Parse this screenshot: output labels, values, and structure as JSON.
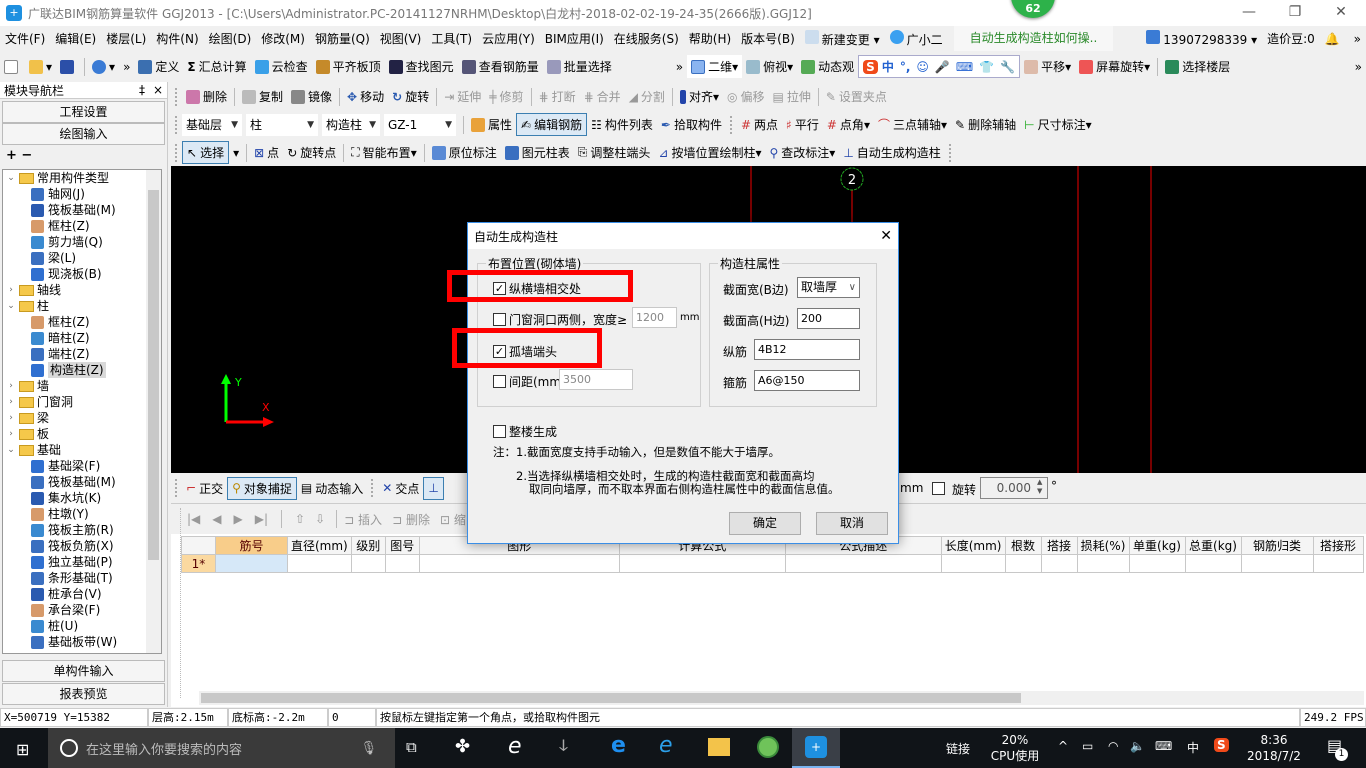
{
  "window": {
    "title": "广联达BIM钢筋算量软件 GGJ2013 - [C:\\Users\\Administrator.PC-20141127NRHM\\Desktop\\白龙村-2018-02-02-19-24-35(2666版).GGJ12]",
    "badge": "62",
    "minimize": "—",
    "restore": "❐",
    "close": "✕"
  },
  "menu": {
    "items": [
      "文件(F)",
      "编辑(E)",
      "楼层(L)",
      "构件(N)",
      "绘图(D)",
      "修改(M)",
      "钢筋量(Q)",
      "视图(V)",
      "工具(T)",
      "云应用(Y)",
      "BIM应用(I)",
      "在线服务(S)",
      "帮助(H)",
      "版本号(B)"
    ],
    "new_change": "新建变更",
    "assistant": "广小二",
    "help_prompt": "自动生成构造柱如何操..",
    "user": "13907298339",
    "beans": "造价豆:0",
    "more": "»"
  },
  "toolbar1": {
    "items": [
      "定义",
      "汇总计算",
      "云检查",
      "平齐板顶",
      "查找图元",
      "查看钢筋量",
      "批量选择"
    ],
    "right": [
      "二维",
      "俯视",
      "动态观"
    ],
    "ime": [
      "中",
      "°,",
      "☺",
      "🎤",
      "⌨"
    ],
    "right2": [
      "平移",
      "屏幕旋转",
      "选择楼层"
    ]
  },
  "toolbar2": {
    "items": [
      "删除",
      "复制",
      "镜像",
      "移动",
      "旋转",
      "延伸",
      "修剪",
      "打断",
      "合并",
      "分割",
      "对齐",
      "偏移",
      "拉伸",
      "设置夹点"
    ],
    "disabled": [
      "延伸",
      "修剪",
      "打断",
      "合并",
      "分割",
      "偏移",
      "拉伸",
      "设置夹点"
    ]
  },
  "toolbar3": {
    "floor": "基础层",
    "type": "柱",
    "subtype": "构造柱",
    "component": "GZ-1",
    "items": [
      "属性",
      "编辑钢筋",
      "构件列表",
      "拾取构件",
      "两点",
      "平行",
      "点角",
      "三点辅轴",
      "删除辅轴",
      "尺寸标注"
    ]
  },
  "toolbar4": {
    "items": [
      "选择",
      "点",
      "旋转点",
      "智能布置",
      "原位标注",
      "图元柱表",
      "调整柱端头",
      "按墙位置绘制柱",
      "查改标注",
      "自动生成构造柱"
    ]
  },
  "nav": {
    "title": "模块导航栏",
    "pin": "‡",
    "close": "×",
    "buttons": [
      "工程设置",
      "绘图输入"
    ],
    "bottom_buttons": [
      "单构件输入",
      "报表预览"
    ],
    "expand_collapse": "+ −",
    "tree": [
      {
        "label": "常用构件类型",
        "level": 0,
        "expanded": true
      },
      {
        "label": "轴网(J)",
        "level": 1
      },
      {
        "label": "筏板基础(M)",
        "level": 1
      },
      {
        "label": "框柱(Z)",
        "level": 1
      },
      {
        "label": "剪力墙(Q)",
        "level": 1
      },
      {
        "label": "梁(L)",
        "level": 1
      },
      {
        "label": "现浇板(B)",
        "level": 1
      },
      {
        "label": "轴线",
        "level": 0,
        "expanded": false
      },
      {
        "label": "柱",
        "level": 0,
        "expanded": true
      },
      {
        "label": "框柱(Z)",
        "level": 1
      },
      {
        "label": "暗柱(Z)",
        "level": 1
      },
      {
        "label": "端柱(Z)",
        "level": 1
      },
      {
        "label": "构造柱(Z)",
        "level": 1,
        "selected": true
      },
      {
        "label": "墙",
        "level": 0,
        "expanded": false
      },
      {
        "label": "门窗洞",
        "level": 0,
        "expanded": false
      },
      {
        "label": "梁",
        "level": 0,
        "expanded": false
      },
      {
        "label": "板",
        "level": 0,
        "expanded": false
      },
      {
        "label": "基础",
        "level": 0,
        "expanded": true
      },
      {
        "label": "基础梁(F)",
        "level": 1
      },
      {
        "label": "筏板基础(M)",
        "level": 1
      },
      {
        "label": "集水坑(K)",
        "level": 1
      },
      {
        "label": "柱墩(Y)",
        "level": 1
      },
      {
        "label": "筏板主筋(R)",
        "level": 1
      },
      {
        "label": "筏板负筋(X)",
        "level": 1
      },
      {
        "label": "独立基础(P)",
        "level": 1
      },
      {
        "label": "条形基础(T)",
        "level": 1
      },
      {
        "label": "桩承台(V)",
        "level": 1
      },
      {
        "label": "承台梁(F)",
        "level": 1
      },
      {
        "label": "桩(U)",
        "level": 1
      },
      {
        "label": "基础板带(W)",
        "level": 1
      }
    ]
  },
  "canvas": {
    "axis_label": "2",
    "y_label": "Y",
    "x_label": "X"
  },
  "snapbar": {
    "items": [
      "正交",
      "对象捕捉",
      "动态输入",
      "交点"
    ],
    "unit": "mm",
    "rotate_label": "旋转",
    "rotate_value": "0.000",
    "degree": "°"
  },
  "grid": {
    "toolbar": [
      "插入",
      "删除",
      "缩"
    ],
    "columns": [
      "",
      "筋号",
      "直径(mm)",
      "级别",
      "图号",
      "图形",
      "计算公式",
      "公式描述",
      "长度(mm)",
      "根数",
      "搭接",
      "损耗(%)",
      "单重(kg)",
      "总重(kg)",
      "钢筋归类",
      "搭接形"
    ],
    "rows": [
      [
        "1*",
        "",
        "",
        "",
        "",
        "",
        "",
        "",
        "",
        "",
        "",
        "",
        "",
        "",
        "",
        ""
      ]
    ]
  },
  "status": {
    "coords": "X=500719 Y=15382",
    "floor_height": "层高:2.15m",
    "base_elev": "底标高:-2.2m",
    "zero": "0",
    "hint": "按鼠标左键指定第一个角点，或拾取构件图元",
    "fps": "249.2 FPS"
  },
  "taskbar": {
    "search_placeholder": "在这里输入你要搜索的内容",
    "link": "链接",
    "cpu_pct": "20%",
    "cpu_label": "CPU使用",
    "ime": "中",
    "time": "8:36",
    "date": "2018/7/2",
    "notif_count": "1"
  },
  "dialog": {
    "title": "自动生成构造柱",
    "group_position": "布置位置(砌体墙)",
    "opt_intersection": {
      "label": "纵横墙相交处",
      "checked": true
    },
    "opt_opening": {
      "label": "门窗洞口两侧，宽度≥",
      "checked": false,
      "value": "1200",
      "unit": "mm"
    },
    "opt_wall_end": {
      "label": "孤墙端头",
      "checked": true
    },
    "opt_spacing": {
      "label": "间距(mm)",
      "checked": false,
      "value": "3500"
    },
    "group_props": "构造柱属性",
    "width_label": "截面宽(B边)",
    "width_value": "取墙厚",
    "height_label": "截面高(H边)",
    "height_value": "200",
    "long_bar_label": "纵筋",
    "long_bar_value": "4B12",
    "stirrup_label": "箍筋",
    "stirrup_value": "A6@150",
    "whole_building": {
      "label": "整楼生成",
      "checked": false
    },
    "note1": "注：1.截面宽度支持手动输入，但是数值不能大于墙厚。",
    "note2a": "2.当选择纵横墙相交处时，生成的构造柱截面宽和截面高均",
    "note2b": "取同向墙厚，而不取本界面右侧构造柱属性中的截面信息值。",
    "ok": "确定",
    "cancel": "取消",
    "close": "✕",
    "check": "✓"
  }
}
